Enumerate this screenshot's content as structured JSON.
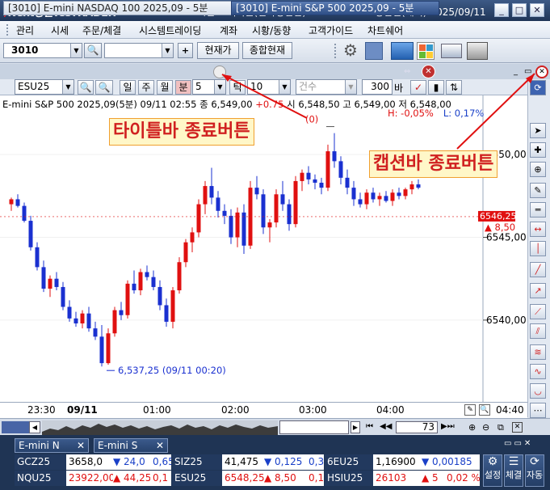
{
  "window": {
    "logo_text": "Next증권YesTRADER",
    "title": "24시간 고객지원(전략영업팀) 02-788-7035   영업일(해외):2025/09/11"
  },
  "menu": [
    "관리",
    "시세",
    "주문/체결",
    "시스템트레이딩",
    "계좌",
    "시황/동향",
    "고객가이드",
    "차트쉐어"
  ],
  "toolbar": {
    "screen_no": "3010",
    "btn_current_price": "현재가",
    "btn_total_current": "종합현재",
    "quick_numbers": [
      "1",
      "2",
      "3",
      "4",
      "5",
      "6"
    ]
  },
  "tabs": [
    {
      "label": "[3010] E-mini NASDAQ 100 2025,09 - 5분"
    },
    {
      "label": "[3010] E-mini S&P 500 2025,09 - 5분"
    }
  ],
  "chart_toolbar": {
    "symbol": "ESU25",
    "periods": [
      "일",
      "주",
      "월",
      "분"
    ],
    "interval": "5",
    "tick_label": "틱",
    "count": "10",
    "volume_combo": "건수",
    "bars": "300",
    "bars_unit": "바"
  },
  "info": {
    "symbol_line": "E-mini S&P 500 2025,09(5분) 09/11 02:55",
    "close_label": "종",
    "close": "6,549,00",
    "change": "+0.75",
    "open_label": "시",
    "open": "6,548,50",
    "high_label": "고",
    "high": "6,549,00",
    "low_label": "저",
    "low": "6,548,00",
    "h_pct": "H: -0,05%",
    "l_pct": "L: 0,17%"
  },
  "chart_data": {
    "type": "candlestick",
    "y_ticks": [
      "6550,00",
      "6545,00",
      "6540,00"
    ],
    "ylim": [
      6535.5,
      6552.5
    ],
    "x_ticks": [
      "23:30",
      "09/11",
      "01:00",
      "02:00",
      "03:00",
      "04:00",
      "04:40"
    ],
    "low_annotation": "6,537,25 (09/11 00:20)",
    "current_price": "6546,25",
    "current_change": "8,50",
    "high_annotation": "(0)",
    "candles": [
      [
        6547.0,
        6547.4,
        6546.6,
        6547.3
      ],
      [
        6547.3,
        6547.6,
        6546.8,
        6546.9
      ],
      [
        6546.9,
        6547.1,
        6545.9,
        6546.0
      ],
      [
        6546.0,
        6546.3,
        6544.2,
        6544.4
      ],
      [
        6544.4,
        6544.7,
        6543.0,
        6543.2
      ],
      [
        6543.2,
        6543.6,
        6541.7,
        6541.9
      ],
      [
        6541.9,
        6542.7,
        6541.4,
        6542.5
      ],
      [
        6542.5,
        6542.9,
        6541.8,
        6542.0
      ],
      [
        6542.0,
        6542.3,
        6540.6,
        6540.8
      ],
      [
        6540.8,
        6541.2,
        6539.9,
        6540.1
      ],
      [
        6540.1,
        6540.5,
        6539.6,
        6539.8
      ],
      [
        6539.8,
        6540.6,
        6539.5,
        6540.4
      ],
      [
        6540.4,
        6540.8,
        6539.3,
        6539.5
      ],
      [
        6539.5,
        6539.9,
        6538.8,
        6539.0
      ],
      [
        6539.0,
        6539.7,
        6537.2,
        6537.4
      ],
      [
        6537.4,
        6539.5,
        6537.3,
        6539.2
      ],
      [
        6539.2,
        6540.8,
        6539.0,
        6540.6
      ],
      [
        6540.6,
        6541.1,
        6540.0,
        6540.3
      ],
      [
        6540.3,
        6542.4,
        6540.1,
        6542.2
      ],
      [
        6542.2,
        6543.0,
        6541.6,
        6541.8
      ],
      [
        6541.8,
        6543.1,
        6541.5,
        6542.9
      ],
      [
        6542.9,
        6543.3,
        6542.4,
        6542.6
      ],
      [
        6542.6,
        6543.0,
        6541.8,
        6542.0
      ],
      [
        6542.0,
        6542.4,
        6540.6,
        6540.9
      ],
      [
        6540.9,
        6541.3,
        6539.6,
        6539.9
      ],
      [
        6539.9,
        6542.0,
        6539.5,
        6541.8
      ],
      [
        6541.8,
        6543.8,
        6541.6,
        6543.5
      ],
      [
        6543.5,
        6544.9,
        6543.2,
        6544.7
      ],
      [
        6544.7,
        6545.6,
        6544.1,
        6545.3
      ],
      [
        6545.3,
        6547.3,
        6545.0,
        6547.0
      ],
      [
        6547.0,
        6548.4,
        6546.4,
        6548.1
      ],
      [
        6548.1,
        6549.2,
        6547.0,
        6547.4
      ],
      [
        6547.4,
        6547.8,
        6546.2,
        6546.6
      ],
      [
        6546.6,
        6547.0,
        6545.8,
        6546.3
      ],
      [
        6546.3,
        6546.7,
        6544.6,
        6545.0
      ],
      [
        6545.0,
        6546.8,
        6544.4,
        6546.5
      ],
      [
        6546.5,
        6547.0,
        6544.0,
        6544.5
      ],
      [
        6544.5,
        6548.4,
        6544.3,
        6548.0
      ],
      [
        6548.0,
        6548.7,
        6547.3,
        6547.6
      ],
      [
        6547.6,
        6547.9,
        6545.2,
        6545.6
      ],
      [
        6545.6,
        6546.1,
        6544.7,
        6545.9
      ],
      [
        6545.9,
        6547.9,
        6545.6,
        6547.6
      ],
      [
        6547.6,
        6548.4,
        6546.6,
        6547.0
      ],
      [
        6547.0,
        6547.3,
        6545.4,
        6545.8
      ],
      [
        6545.8,
        6548.7,
        6545.6,
        6548.4
      ],
      [
        6548.4,
        6549.1,
        6547.8,
        6548.9
      ],
      [
        6548.9,
        6549.3,
        6548.2,
        6548.5
      ],
      [
        6548.5,
        6548.8,
        6547.9,
        6548.3
      ],
      [
        6548.3,
        6548.6,
        6547.6,
        6548.0
      ],
      [
        6548.0,
        6550.6,
        6547.8,
        6550.2
      ],
      [
        6550.2,
        6551.3,
        6549.2,
        6549.6
      ],
      [
        6549.6,
        6549.9,
        6548.2,
        6548.6
      ],
      [
        6548.6,
        6549.1,
        6547.6,
        6548.0
      ],
      [
        6548.0,
        6548.4,
        6546.9,
        6547.3
      ],
      [
        6547.3,
        6547.7,
        6546.8,
        6547.0
      ],
      [
        6547.0,
        6547.9,
        6546.7,
        6547.7
      ],
      [
        6547.7,
        6548.0,
        6547.1,
        6547.3
      ],
      [
        6547.3,
        6547.7,
        6546.9,
        6547.5
      ],
      [
        6547.5,
        6547.8,
        6547.1,
        6547.2
      ],
      [
        6547.2,
        6547.9,
        6546.9,
        6547.7
      ],
      [
        6547.7,
        6548.0,
        6547.3,
        6547.5
      ],
      [
        6547.5,
        6548.0,
        6547.3,
        6547.9
      ],
      [
        6547.9,
        6548.4,
        6547.6,
        6548.2
      ],
      [
        6548.2,
        6548.5,
        6547.9,
        6548.0
      ]
    ]
  },
  "ticker_tabs": [
    "E-mini N",
    "E-mini S"
  ],
  "tickers": [
    [
      {
        "name": "GCZ25",
        "price": "3658,0",
        "dir": "dn",
        "chg": "24,0",
        "pct": "0,65"
      },
      {
        "name": "SIZ25",
        "price": "41,475",
        "dir": "dn",
        "chg": "0,125",
        "pct": "0,3"
      },
      {
        "name": "6EU25",
        "price": "1,16900",
        "dir": "dn",
        "chg": "0,00185",
        "pct": ""
      }
    ],
    [
      {
        "name": "NQU25",
        "price": "23922,00",
        "dir": "up",
        "chg": "44,25",
        "pct": "0,1"
      },
      {
        "name": "ESU25",
        "price": "6548,25",
        "dir": "up",
        "chg": "8,50",
        "pct": "0,1"
      },
      {
        "name": "HSIU25",
        "price": "26103",
        "dir": "up",
        "chg": "5",
        "pct": "0,02 %"
      }
    ]
  ],
  "bottom_buttons": [
    "설정",
    "체결",
    "자동"
  ],
  "scroll": {
    "count": "73"
  },
  "callouts": {
    "titlebar_close": "타이틀바 종료버튼",
    "caption_close": "캡션바 종료버튼"
  }
}
